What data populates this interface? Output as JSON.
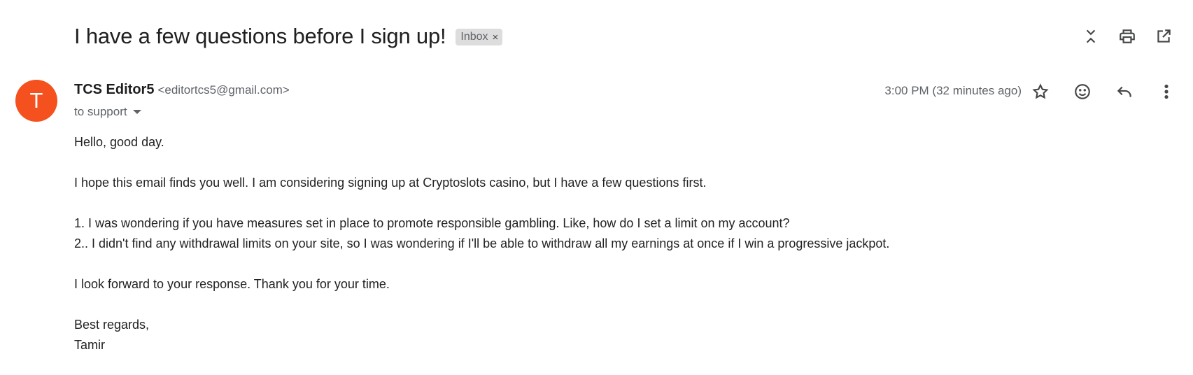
{
  "email": {
    "subject": "I have a few questions before I sign up!",
    "label": "Inbox",
    "label_remove": "×",
    "sender": {
      "avatar_letter": "T",
      "avatar_color": "#f4511e",
      "name": "TCS Editor5",
      "email": "<editortcs5@gmail.com>"
    },
    "to": "to support",
    "time": "3:00 PM (32 minutes ago)",
    "body": {
      "greeting": "Hello, good day.",
      "intro": "I hope this email finds you well. I am considering signing up at Cryptoslots casino, but I have a few questions first.",
      "q1": "1. I was wondering if you have measures set in place to promote responsible gambling. Like, how do I set a limit on my account?",
      "q2": "2.. I didn't find any withdrawal limits on your site, so I was wondering if I'll be able to withdraw all my earnings at once if I win a progressive jackpot.",
      "closing": "I look forward to your response. Thank you for your time.",
      "signoff": "Best regards,",
      "signature": "Tamir"
    }
  },
  "icons": {
    "top": [
      "collapse-all-icon",
      "print-icon",
      "open-in-new-window-icon"
    ],
    "message": [
      "star-icon",
      "emoji-reaction-icon",
      "reply-icon",
      "more-vert-icon"
    ]
  }
}
